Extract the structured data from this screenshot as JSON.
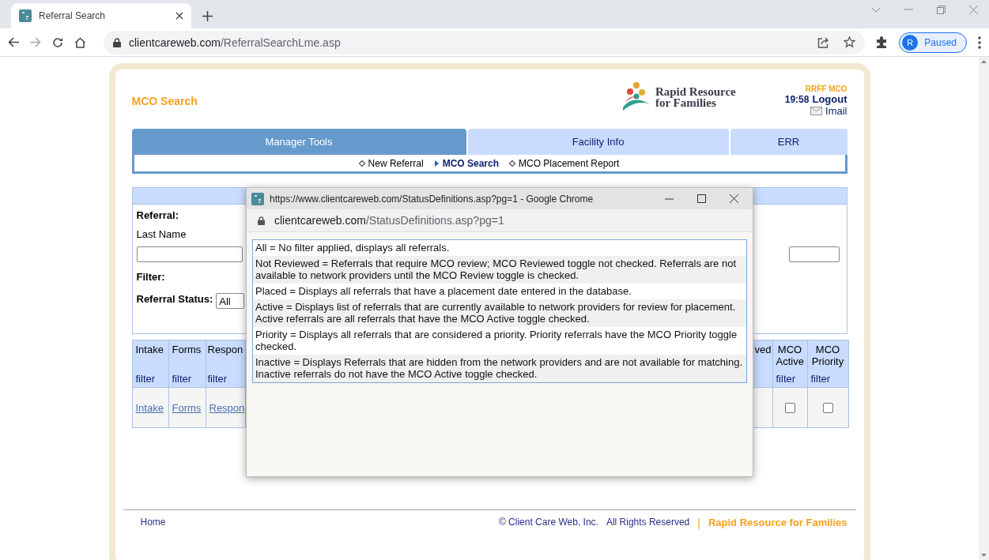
{
  "browser": {
    "tabs": [
      {
        "title": "Referral Search",
        "selected": true
      }
    ],
    "address": {
      "host": "clientcareweb.com",
      "path": "/ReferralSearchLme.asp"
    },
    "profile": {
      "initial": "R",
      "status": "Paused"
    }
  },
  "page": {
    "title": "MCO Search",
    "logo": {
      "line_1": "Rapid Resource",
      "line_2": "for Families"
    },
    "user": {
      "org": "RRFF MCO",
      "time": "19:58",
      "logout": "Logout",
      "email": "Imail"
    },
    "tabs": [
      {
        "label": "Manager Tools",
        "selected": true
      },
      {
        "label": "Facility Info",
        "selected": false
      },
      {
        "label": "ERR",
        "selected": false
      }
    ],
    "subnav": [
      {
        "label": "New Referral",
        "selected": false
      },
      {
        "label": "MCO Search",
        "selected": true
      },
      {
        "label": "MCO Placement Report",
        "selected": false
      }
    ],
    "search": {
      "section": "Referral:",
      "last_name_label": "Last Name",
      "filter_label": "Filter:",
      "status_label": "Referral Status:",
      "status_value": "All"
    },
    "table": {
      "columns": [
        {
          "label": "Intake",
          "filter": "filter"
        },
        {
          "label": "Forms",
          "filter": "filter"
        },
        {
          "label": "Respon",
          "filter": "filter"
        },
        {
          "label": "ved"
        },
        {
          "label": "MCO Active",
          "filter": "filter"
        },
        {
          "label": "MCO Priority",
          "filter": "filter"
        }
      ],
      "rows": [
        {
          "cells": [
            {
              "kind": "link",
              "text": "Intake"
            },
            {
              "kind": "link",
              "text": "Forms"
            },
            {
              "kind": "link",
              "text": "Respon"
            },
            {
              "kind": "blank"
            },
            {
              "kind": "checkbox",
              "checked": false
            },
            {
              "kind": "checkbox",
              "checked": false
            }
          ]
        }
      ]
    },
    "footer": {
      "home": "Home",
      "copyright": "© Client Care Web, Inc.",
      "rights": "All Rights Reserved",
      "separator": "|",
      "brand": "Rapid Resource for Families"
    }
  },
  "popup": {
    "title": "https://www.clientcareweb.com/StatusDefinitions.asp?pg=1 - Google Chrome",
    "address": {
      "host": "clientcareweb.com",
      "path": "/StatusDefinitions.asp?pg=1"
    },
    "definitions": [
      "All = No filter applied, displays all referrals.",
      "Not Reviewed = Referrals that require MCO review; MCO Reviewed toggle not checked. Referrals are not available to network providers until the MCO Review toggle is checked.",
      "Placed = Displays all referrals that have a placement date entered in the database.",
      "Active = Displays list of referrals that are currently available to network providers for review for placement. Active referrals are all referrals that have the MCO Active toggle checked.",
      "Priority = Displays all referrals that are considered a priority. Priority referrals have the MCO Priority toggle checked.",
      "Inactive = Displays Referrals that are hidden from the network providers and are not available for matching. Inactive referrals do not have the MCO Active toggle checked."
    ]
  }
}
